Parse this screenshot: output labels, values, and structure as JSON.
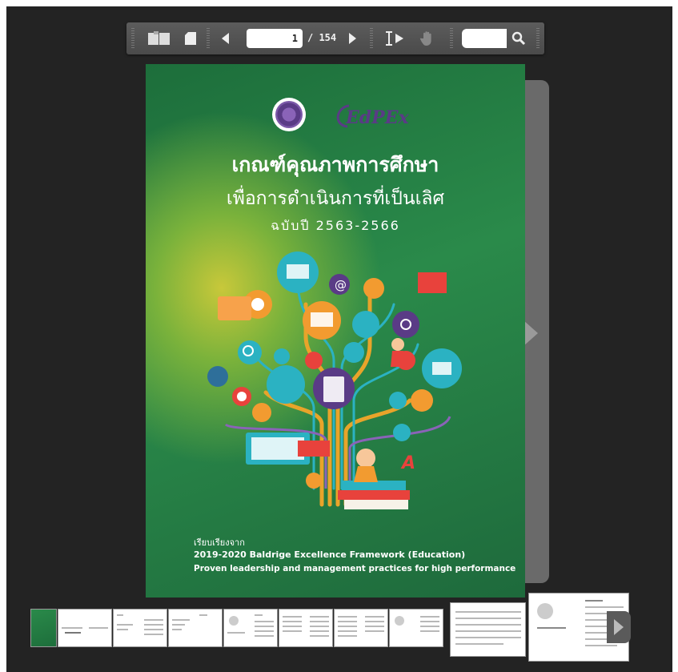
{
  "toolbar": {
    "current_page": "1",
    "page_total": "/ 154",
    "icons": [
      "double-page-icon",
      "single-page-icon",
      "prev-page-icon",
      "next-page-icon",
      "text-select-icon",
      "hand-tool-icon",
      "search-icon"
    ]
  },
  "cover": {
    "title_line1": "เกณฑ์คุณภาพการศึกษา",
    "title_line2": "เพื่อการดำเนินการที่เป็นเลิศ",
    "edition": "ฉบับปี 2563-2566",
    "logo_text": "EdPEx",
    "compiled_from": "เรียบเรียงจาก",
    "source_line1": "2019-2020 Baldrige Excellence Framework (Education)",
    "source_line2": "Proven leadership and management practices for high performance"
  },
  "colors": {
    "background": "#232323",
    "toolbar": "#535353",
    "cover_green": "#1f7a40"
  }
}
